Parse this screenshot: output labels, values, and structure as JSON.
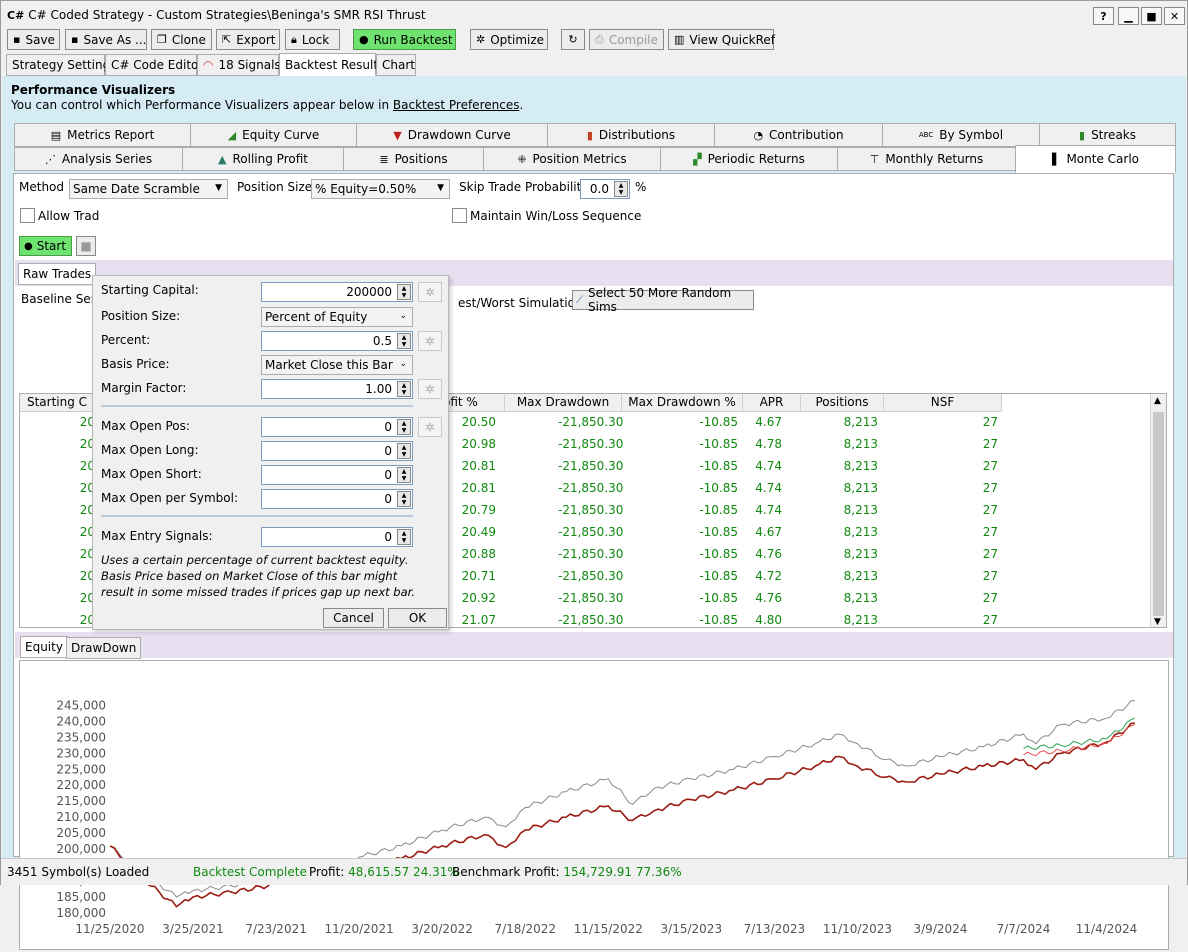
{
  "window": {
    "title": "C# Coded Strategy - Custom Strategies\\Beninga's SMR RSI Thrust",
    "app_icon": "C#",
    "help": "?",
    "minimize": "▁",
    "maximize": "■",
    "close": "✕"
  },
  "toolbar": {
    "save": "Save",
    "save_as": "Save As ...",
    "clone": "Clone",
    "export": "Export",
    "lock": "Lock",
    "run_backtest": "Run Backtest",
    "optimize": "Optimize",
    "compile": "Compile",
    "quickref": "View QuickRef"
  },
  "main_tabs": [
    "Strategy Settings",
    "C# Code Editor",
    "18 Signals",
    "Backtest Results",
    "Chart"
  ],
  "perf": {
    "title": "Performance Visualizers",
    "sub_prefix": "You can control which Performance Visualizers appear below in ",
    "sub_link": "Backtest Preferences",
    "sub_suffix": "."
  },
  "viz_tabs_row1": [
    "Metrics Report",
    "Equity Curve",
    "Drawdown Curve",
    "Distributions",
    "Contribution",
    "By Symbol",
    "Streaks"
  ],
  "viz_tabs_row2": [
    "Analysis Series",
    "Rolling Profit",
    "Positions",
    "Position Metrics",
    "Periodic Returns",
    "Monthly Returns",
    "Monte Carlo"
  ],
  "mc": {
    "method_label": "Method",
    "method_value": "Same Date Scramble",
    "possize_label": "Position Size",
    "possize_value": "% Equity=0.50%",
    "skip_label": "Skip Trade Probability",
    "skip_value": "0.0",
    "skip_unit": "%",
    "allow_label": "Allow Trad",
    "maintain_label": "Maintain Win/Loss Sequence",
    "start": "Start",
    "raw_trades": "Raw Trades",
    "baseline": "Baseline Seria",
    "bestworst": "est/Worst Simulations",
    "select50": "Select 50 More Random Sims"
  },
  "grid": {
    "headers": [
      "Starting C",
      "ofit %",
      "Max Drawdown",
      "Max Drawdown %",
      "APR",
      "Positions",
      "NSF"
    ],
    "rows": [
      [
        "20",
        "20.50",
        "-21,850.30",
        "-10.85",
        "4.67",
        "8,213",
        "27"
      ],
      [
        "20",
        "20.98",
        "-21,850.30",
        "-10.85",
        "4.78",
        "8,213",
        "27"
      ],
      [
        "20",
        "20.81",
        "-21,850.30",
        "-10.85",
        "4.74",
        "8,213",
        "27"
      ],
      [
        "20",
        "20.81",
        "-21,850.30",
        "-10.85",
        "4.74",
        "8,213",
        "27"
      ],
      [
        "20",
        "20.79",
        "-21,850.30",
        "-10.85",
        "4.74",
        "8,213",
        "27"
      ],
      [
        "20",
        "20.49",
        "-21,850.30",
        "-10.85",
        "4.67",
        "8,213",
        "27"
      ],
      [
        "20",
        "20.88",
        "-21,850.30",
        "-10.85",
        "4.76",
        "8,213",
        "27"
      ],
      [
        "20",
        "20.71",
        "-21,850.30",
        "-10.85",
        "4.72",
        "8,213",
        "27"
      ],
      [
        "20",
        "20.92",
        "-21,850.30",
        "-10.85",
        "4.76",
        "8,213",
        "27"
      ],
      [
        "20",
        "21.07",
        "-21,850.30",
        "-10.85",
        "4.80",
        "8,213",
        "27"
      ]
    ]
  },
  "popup": {
    "starting_capital_label": "Starting Capital:",
    "starting_capital": "200000",
    "position_size_label": "Position Size:",
    "position_size": "Percent of Equity",
    "percent_label": "Percent:",
    "percent": "0.5",
    "basis_label": "Basis Price:",
    "basis": "Market Close this Bar",
    "margin_label": "Margin Factor:",
    "margin": "1.00",
    "max_open_pos_label": "Max Open Pos:",
    "max_open_pos": "0",
    "max_open_long_label": "Max Open Long:",
    "max_open_long": "0",
    "max_open_short_label": "Max Open Short:",
    "max_open_short": "0",
    "max_open_sym_label": "Max Open per Symbol:",
    "max_open_sym": "0",
    "max_entry_label": "Max Entry Signals:",
    "max_entry": "0",
    "note": "Uses a certain percentage of current backtest equity. Basis Price based on Market Close of this bar might result in some missed trades if prices gap up next bar.",
    "cancel": "Cancel",
    "ok": "OK"
  },
  "chart_tabs": [
    "Equity",
    "DrawDown"
  ],
  "chart_data": {
    "type": "line",
    "title": "",
    "xlabel": "",
    "ylabel": "",
    "x_ticks": [
      "11/25/2020",
      "3/25/2021",
      "7/23/2021",
      "11/20/2021",
      "3/20/2022",
      "7/18/2022",
      "11/15/2022",
      "3/15/2023",
      "7/13/2023",
      "11/10/2023",
      "3/9/2024",
      "7/7/2024",
      "11/4/2024"
    ],
    "y_ticks": [
      "245,000",
      "240,000",
      "235,000",
      "230,000",
      "225,000",
      "220,000",
      "215,000",
      "210,000",
      "205,000",
      "200,000",
      "195,000",
      "190,000",
      "185,000",
      "180,000"
    ],
    "ylim": [
      180000,
      247000
    ],
    "series": [
      {
        "color": "#8a8a8a",
        "points": [
          [
            "11/25/2020",
            201000
          ],
          [
            "1/10/2021",
            193000
          ],
          [
            "3/1/2021",
            185000
          ],
          [
            "3/25/2021",
            187000
          ],
          [
            "5/20/2021",
            188500
          ],
          [
            "7/23/2021",
            191000
          ],
          [
            "9/20/2021",
            194000
          ],
          [
            "11/20/2021",
            197500
          ],
          [
            "1/20/2022",
            201000
          ],
          [
            "3/20/2022",
            206000
          ],
          [
            "5/20/2022",
            210000
          ],
          [
            "6/20/2022",
            207000
          ],
          [
            "7/18/2022",
            213000
          ],
          [
            "9/15/2022",
            218000
          ],
          [
            "11/15/2022",
            222000
          ],
          [
            "12/20/2022",
            214000
          ],
          [
            "1/20/2023",
            219000
          ],
          [
            "3/15/2023",
            222000
          ],
          [
            "5/15/2023",
            225000
          ],
          [
            "7/13/2023",
            229000
          ],
          [
            "9/10/2023",
            233000
          ],
          [
            "10/15/2023",
            236000
          ],
          [
            "11/10/2023",
            233000
          ],
          [
            "12/20/2023",
            228000
          ],
          [
            "1/20/2024",
            226000
          ],
          [
            "3/9/2024",
            229000
          ],
          [
            "5/10/2024",
            232000
          ],
          [
            "7/7/2024",
            236000
          ],
          [
            "7/25/2024",
            233000
          ],
          [
            "8/30/2024",
            239000
          ],
          [
            "11/4/2024",
            241000
          ],
          [
            "12/15/2024",
            246500
          ]
        ]
      },
      {
        "color": "#9b1c10",
        "points": [
          [
            "11/25/2020",
            201000
          ],
          [
            "1/10/2021",
            191000
          ],
          [
            "3/1/2021",
            182000
          ],
          [
            "3/25/2021",
            185000
          ],
          [
            "5/20/2021",
            186500
          ],
          [
            "7/23/2021",
            189000
          ],
          [
            "9/20/2021",
            191500
          ],
          [
            "11/20/2021",
            194500
          ],
          [
            "1/20/2022",
            197000
          ],
          [
            "3/20/2022",
            201000
          ],
          [
            "5/20/2022",
            204500
          ],
          [
            "6/20/2022",
            200500
          ],
          [
            "7/18/2022",
            206000
          ],
          [
            "9/15/2022",
            210000
          ],
          [
            "11/15/2022",
            213500
          ],
          [
            "12/20/2022",
            209000
          ],
          [
            "1/20/2023",
            212000
          ],
          [
            "3/15/2023",
            215500
          ],
          [
            "5/15/2023",
            218500
          ],
          [
            "7/13/2023",
            222000
          ],
          [
            "9/10/2023",
            226000
          ],
          [
            "10/15/2023",
            229000
          ],
          [
            "11/10/2023",
            226000
          ],
          [
            "12/20/2023",
            222500
          ],
          [
            "1/20/2024",
            221000
          ],
          [
            "3/9/2024",
            223500
          ],
          [
            "5/10/2024",
            226000
          ],
          [
            "7/7/2024",
            228000
          ],
          [
            "7/25/2024",
            225000
          ],
          [
            "8/30/2024",
            230000
          ],
          [
            "11/4/2024",
            233500
          ],
          [
            "12/15/2024",
            239500
          ]
        ]
      },
      {
        "color": "#2aa050",
        "points": [
          [
            "7/7/2024",
            231500
          ],
          [
            "8/30/2024",
            232500
          ],
          [
            "11/4/2024",
            234500
          ],
          [
            "12/15/2024",
            241000
          ]
        ]
      },
      {
        "color": "#e85050",
        "points": [
          [
            "7/7/2024",
            229500
          ],
          [
            "8/30/2024",
            230800
          ],
          [
            "11/4/2024",
            233000
          ],
          [
            "12/15/2024",
            239000
          ]
        ]
      }
    ]
  },
  "status": {
    "symbols": "3451 Symbol(s) Loaded",
    "backtest": "Backtest Complete",
    "profit_label": "Profit: ",
    "profit": "48,615.57 24.31%",
    "bench_label": "Benchmark Profit: ",
    "bench": "154,729.91 77.36%"
  },
  "icons": {
    "save": "disk-icon",
    "run": "play-icon",
    "gear": "gear-icon"
  }
}
